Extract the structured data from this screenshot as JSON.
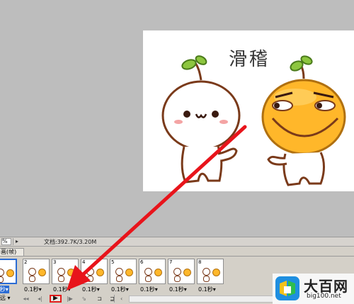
{
  "canvas": {
    "title_text": "滑稽",
    "background": "#ffffff",
    "workspace_bg": "#bdbdbd"
  },
  "status_bar": {
    "zoom": "%",
    "doc_info": "文档:392.7K/3.20M"
  },
  "animation_panel": {
    "tab_label": "画(帧)",
    "frames": [
      {
        "number": "1",
        "delay": "0.1秒▾",
        "selected": true
      },
      {
        "number": "2",
        "delay": "0.1秒▾",
        "selected": false
      },
      {
        "number": "3",
        "delay": "0.1秒▾",
        "selected": false
      },
      {
        "number": "4",
        "delay": "0.1秒▾",
        "selected": false
      },
      {
        "number": "5",
        "delay": "0.1秒▾",
        "selected": false
      },
      {
        "number": "6",
        "delay": "0.1秒▾",
        "selected": false
      },
      {
        "number": "7",
        "delay": "0.1秒▾",
        "selected": false
      },
      {
        "number": "8",
        "delay": "0.1秒▾",
        "selected": false
      }
    ],
    "loop_option": "远 ▾",
    "controls": {
      "first_frame": "◂◂",
      "prev_frame": "◂|",
      "play": "▶",
      "next_frame": "|▶",
      "tween": "⇘",
      "duplicate": "⊐",
      "delete": "⊒"
    }
  },
  "annotation": {
    "arrow_color": "#e8141b",
    "highlight_color": "#e21b1b"
  },
  "watermark": {
    "title": "大百网",
    "url": "big100.net"
  },
  "icons": [
    "white-mascot-icon",
    "orange-mascot-icon",
    "play-icon",
    "watermark-logo-icon"
  ]
}
